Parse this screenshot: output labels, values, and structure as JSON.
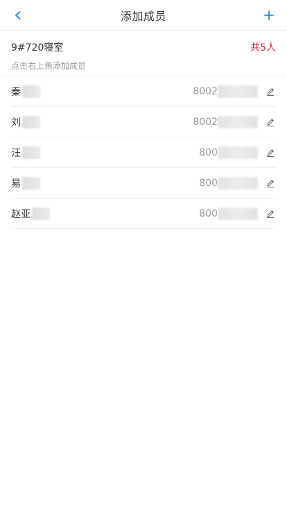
{
  "header": {
    "title": "添加成员",
    "back_icon": "chevron-left-icon",
    "add_icon": "plus-icon"
  },
  "room": {
    "name": "9#720寝室",
    "count_label": "共5人",
    "hint": "点击右上角添加成员"
  },
  "members": [
    {
      "name": "秦",
      "id": "8002"
    },
    {
      "name": "刘",
      "id": "8002"
    },
    {
      "name": "汪",
      "id": "800"
    },
    {
      "name": "易",
      "id": "800"
    },
    {
      "name": "赵亚",
      "id": "800"
    }
  ],
  "colors": {
    "accent": "#1f8ef1",
    "count": "#e01e2a",
    "muted": "#999999",
    "divider": "#eeeeee"
  }
}
